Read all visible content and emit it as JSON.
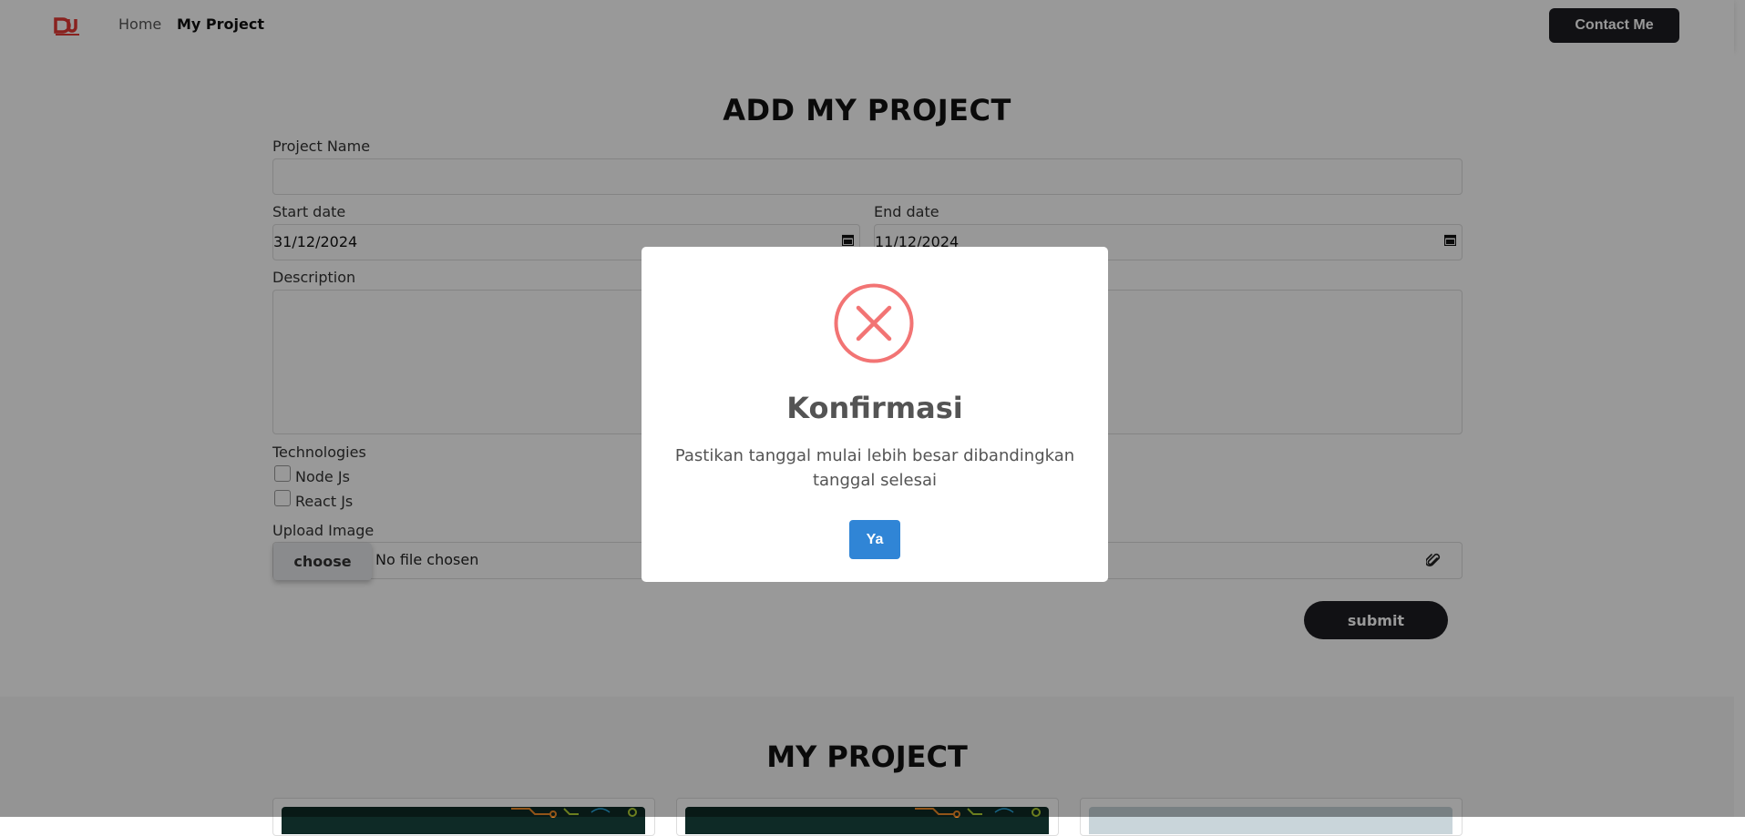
{
  "navbar": {
    "logo_text": "DW",
    "links": [
      "Home",
      "My Project"
    ],
    "contact_label": "Contact Me"
  },
  "form": {
    "title": "ADD MY PROJECT",
    "project_name_label": "Project Name",
    "project_name_value": "",
    "start_date_label": "Start date",
    "start_date_value": "31/12/2024",
    "end_date_label": "End date",
    "end_date_value": "11/12/2024",
    "description_label": "Description",
    "description_value": "",
    "technologies_label": "Technologies",
    "technologies": [
      {
        "label": "Node Js",
        "checked": false
      },
      {
        "label": "React Js",
        "checked": false
      }
    ],
    "upload_label": "Upload Image",
    "choose_label": "choose",
    "no_file_text": "No file chosen",
    "submit_label": "submit"
  },
  "projects_section": {
    "title": "MY PROJECT"
  },
  "modal": {
    "icon": "error-x-icon",
    "title": "Konfirmasi",
    "message": "Pastikan tanggal mulai lebih besar dibandingkan tanggal selesai",
    "confirm_label": "Ya"
  },
  "colors": {
    "dark_button": "#1d1d22",
    "modal_error_red": "#f27474",
    "confirm_blue": "#3085d6",
    "logo_red": "#e53935"
  }
}
